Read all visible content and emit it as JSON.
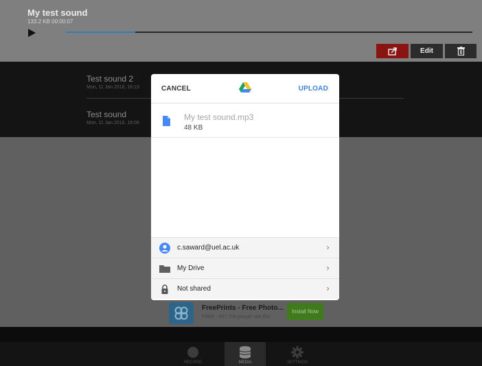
{
  "player": {
    "title": "My test sound",
    "meta": "133.2 KB 00:00:07",
    "progress": 0.17
  },
  "toolbar": {
    "edit_label": "Edit",
    "share_icon": "share-icon",
    "trash_icon": "trash-icon"
  },
  "recordings": [
    {
      "title": "Test sound 2",
      "date": "Mon, 11 Jan 2016, 16:13"
    },
    {
      "title": "Test sound",
      "date": "Mon, 11 Jan 2016, 16:06"
    }
  ],
  "ad": {
    "title": "FreePrints - Free Photo...",
    "subtitle": "FREE - 507,706 people use this",
    "install_label": "Install Now"
  },
  "tabs": [
    {
      "label": "RECORD",
      "icon": "record-icon",
      "active": false
    },
    {
      "label": "MEDIA",
      "icon": "database-icon",
      "active": true
    },
    {
      "label": "SETTINGS",
      "icon": "gear-icon",
      "active": false
    }
  ],
  "sheet": {
    "cancel_label": "CANCEL",
    "upload_label": "UPLOAD",
    "logo_icon": "google-drive-icon",
    "file": {
      "name": "My test sound.mp3",
      "size": "48 KB",
      "icon": "file-icon"
    },
    "options": [
      {
        "label": "c.saward@uel.ac.uk",
        "icon": "account-icon"
      },
      {
        "label": "My Drive",
        "icon": "folder-icon"
      },
      {
        "label": "Not shared",
        "icon": "lock-icon"
      }
    ]
  },
  "colors": {
    "upload_accent": "#3e82d6",
    "share_button": "#8a1411",
    "progress": "#2f7fb7",
    "install_button": "#3f7a1c"
  }
}
